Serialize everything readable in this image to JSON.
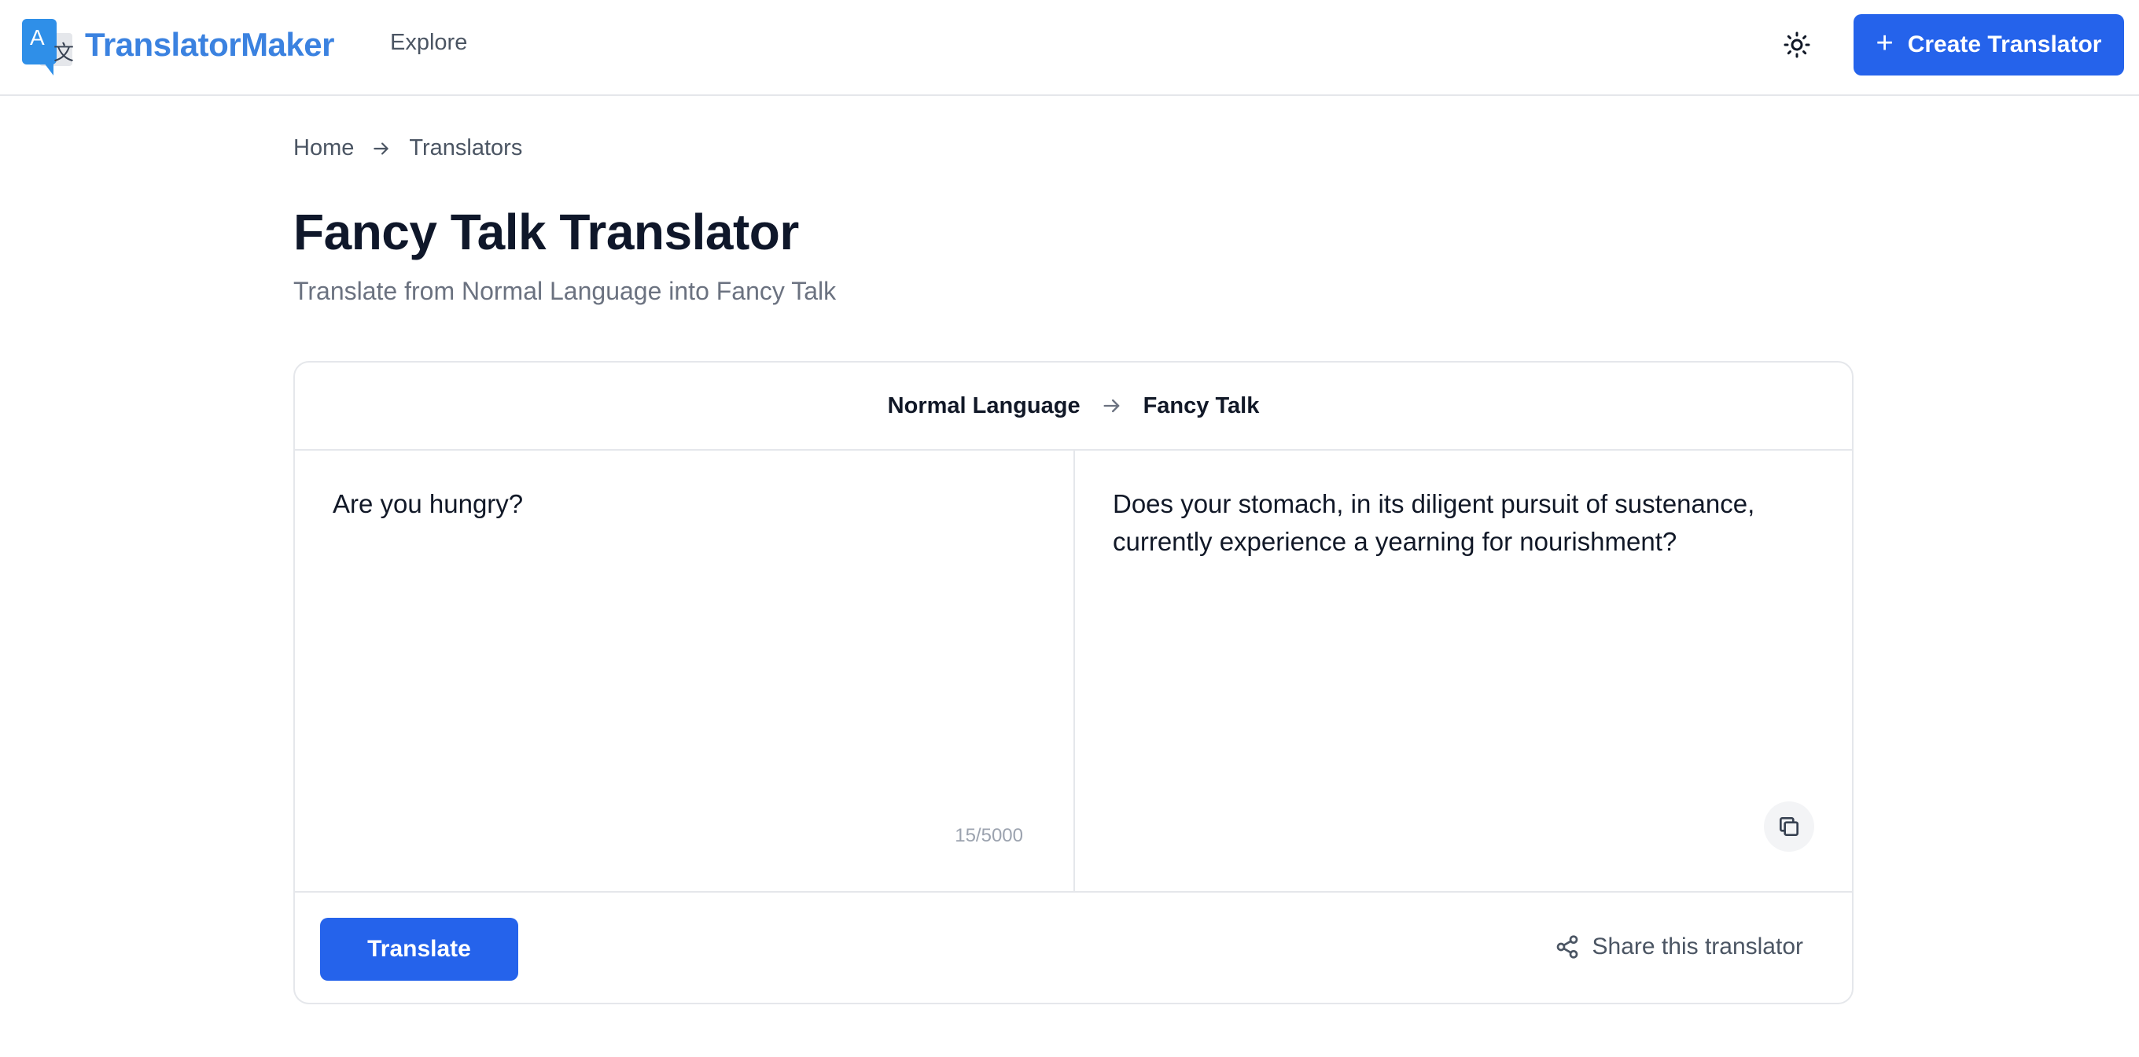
{
  "header": {
    "brand": "TranslatorMaker",
    "logo_glyph_latin": "A",
    "logo_glyph_cjk": "文",
    "nav_explore": "Explore",
    "theme_icon": "sun-icon",
    "create_button": {
      "icon": "plus-icon",
      "label": "Create Translator"
    }
  },
  "breadcrumb": {
    "items": [
      "Home",
      "Translators"
    ],
    "separator_icon": "arrow-right-icon"
  },
  "page": {
    "title": "Fancy Talk Translator",
    "subtitle": "Translate from Normal Language into Fancy Talk"
  },
  "translator": {
    "source_language": "Normal Language",
    "target_language": "Fancy Talk",
    "direction_icon": "arrow-right-icon",
    "input_value": "Are you hungry?",
    "char_count": "15/5000",
    "output_text": "Does your stomach, in its diligent pursuit of sustenance, currently experience a yearning for nourishment?",
    "copy_icon": "copy-icon",
    "translate_button": "Translate",
    "share": {
      "icon": "share-icon",
      "label": "Share this translator"
    }
  },
  "colors": {
    "primary": "#2563eb",
    "brand_text": "#3b82e0",
    "border": "#e5e7eb",
    "muted_text": "#6b7280"
  }
}
